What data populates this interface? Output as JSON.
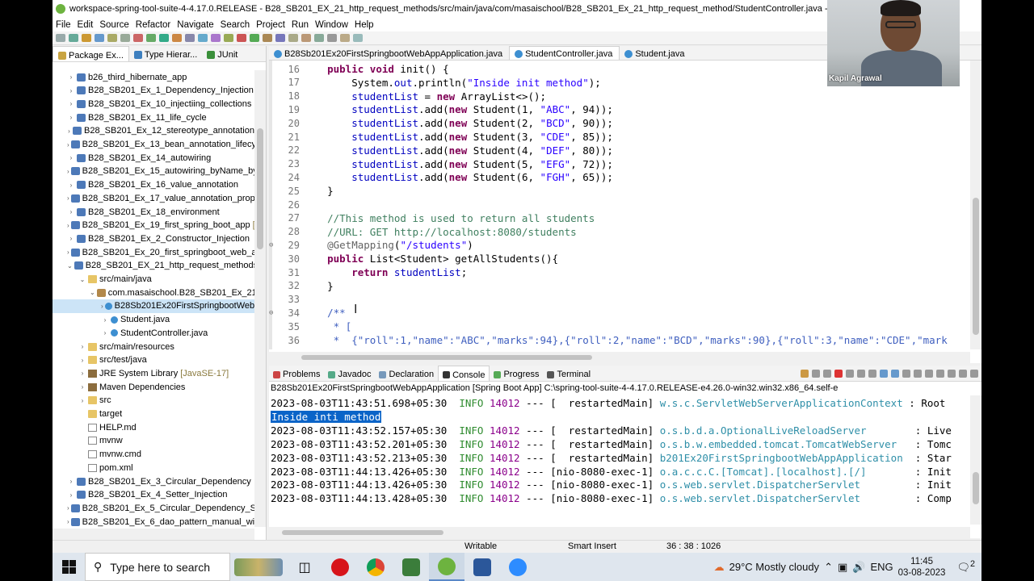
{
  "window": {
    "title": "workspace-spring-tool-suite-4-4.17.0.RELEASE - B28_SB201_EX_21_http_request_methods/src/main/java/com/masaischool/B28_SB201_Ex_21_http_request_method/StudentController.java - Spring Too"
  },
  "menu": [
    "File",
    "Edit",
    "Source",
    "Refactor",
    "Navigate",
    "Search",
    "Project",
    "Run",
    "Window",
    "Help"
  ],
  "left_panel": {
    "tabs": [
      {
        "label": "Package Ex..."
      },
      {
        "label": "Type Hierar..."
      },
      {
        "label": "JUnit"
      }
    ],
    "tree": [
      {
        "indent": 0,
        "arrow": "›",
        "icon": "proj",
        "label": "b26_third_hibernate_app",
        "deco": ""
      },
      {
        "indent": 0,
        "arrow": "›",
        "icon": "proj",
        "label": "B28_SB201_Ex_1_Dependency_Injection",
        "deco": ""
      },
      {
        "indent": 0,
        "arrow": "›",
        "icon": "proj",
        "label": "B28_SB201_Ex_10_injectiing_collections",
        "deco": ""
      },
      {
        "indent": 0,
        "arrow": "›",
        "icon": "proj",
        "label": "B28_SB201_Ex_11_life_cycle",
        "deco": ""
      },
      {
        "indent": 0,
        "arrow": "›",
        "icon": "proj",
        "label": "B28_SB201_Ex_12_stereotype_annotation",
        "deco": ""
      },
      {
        "indent": 0,
        "arrow": "›",
        "icon": "proj",
        "label": "B28_SB201_Ex_13_bean_annotation_lifecyle",
        "deco": ""
      },
      {
        "indent": 0,
        "arrow": "›",
        "icon": "proj",
        "label": "B28_SB201_Ex_14_autowiring",
        "deco": ""
      },
      {
        "indent": 0,
        "arrow": "›",
        "icon": "proj",
        "label": "B28_SB201_Ex_15_autowiring_byName_byTy",
        "deco": ""
      },
      {
        "indent": 0,
        "arrow": "›",
        "icon": "proj",
        "label": "B28_SB201_Ex_16_value_annotation",
        "deco": ""
      },
      {
        "indent": 0,
        "arrow": "›",
        "icon": "proj",
        "label": "B28_SB201_Ex_17_value_annotation_propert",
        "deco": ""
      },
      {
        "indent": 0,
        "arrow": "›",
        "icon": "proj",
        "label": "B28_SB201_Ex_18_environment",
        "deco": ""
      },
      {
        "indent": 0,
        "arrow": "›",
        "icon": "proj",
        "label": "B28_SB201_Ex_19_first_spring_boot_app",
        "deco": "[bc"
      },
      {
        "indent": 0,
        "arrow": "›",
        "icon": "proj",
        "label": "B28_SB201_Ex_2_Constructor_Injection",
        "deco": ""
      },
      {
        "indent": 0,
        "arrow": "›",
        "icon": "proj",
        "label": "B28_SB201_Ex_20_first_springboot_web_app",
        "deco": ""
      },
      {
        "indent": 0,
        "arrow": "⌄",
        "icon": "proj",
        "label": "B28_SB201_EX_21_http_request_methods",
        "deco": "[b"
      },
      {
        "indent": 1,
        "arrow": "⌄",
        "icon": "folder",
        "label": "src/main/java",
        "deco": ""
      },
      {
        "indent": 2,
        "arrow": "⌄",
        "icon": "pkg",
        "label": "com.masaischool.B28_SB201_Ex_21_h",
        "deco": ""
      },
      {
        "indent": 3,
        "arrow": "›",
        "icon": "jfile",
        "label": "B28Sb201Ex20FirstSpringbootWeb",
        "deco": "",
        "selected": true
      },
      {
        "indent": 3,
        "arrow": "›",
        "icon": "jfile",
        "label": "Student.java",
        "deco": ""
      },
      {
        "indent": 3,
        "arrow": "›",
        "icon": "jfile",
        "label": "StudentController.java",
        "deco": ""
      },
      {
        "indent": 1,
        "arrow": "›",
        "icon": "folder",
        "label": "src/main/resources",
        "deco": ""
      },
      {
        "indent": 1,
        "arrow": "›",
        "icon": "folder",
        "label": "src/test/java",
        "deco": ""
      },
      {
        "indent": 1,
        "arrow": "›",
        "icon": "jar",
        "label": "JRE System Library",
        "deco": "[JavaSE-17]"
      },
      {
        "indent": 1,
        "arrow": "›",
        "icon": "jar",
        "label": "Maven Dependencies",
        "deco": ""
      },
      {
        "indent": 1,
        "arrow": "›",
        "icon": "folder",
        "label": "src",
        "deco": ""
      },
      {
        "indent": 1,
        "arrow": "",
        "icon": "folder",
        "label": "target",
        "deco": ""
      },
      {
        "indent": 1,
        "arrow": "",
        "icon": "doc",
        "label": "HELP.md",
        "deco": ""
      },
      {
        "indent": 1,
        "arrow": "",
        "icon": "doc",
        "label": "mvnw",
        "deco": ""
      },
      {
        "indent": 1,
        "arrow": "",
        "icon": "doc",
        "label": "mvnw.cmd",
        "deco": ""
      },
      {
        "indent": 1,
        "arrow": "",
        "icon": "doc",
        "label": "pom.xml",
        "deco": ""
      },
      {
        "indent": 0,
        "arrow": "›",
        "icon": "proj",
        "label": "B28_SB201_Ex_3_Circular_Dependency",
        "deco": ""
      },
      {
        "indent": 0,
        "arrow": "›",
        "icon": "proj",
        "label": "B28_SB201_Ex_4_Setter_Injection",
        "deco": ""
      },
      {
        "indent": 0,
        "arrow": "›",
        "icon": "proj",
        "label": "B28_SB201_Ex_5_Circular_Dependency_Solut",
        "deco": ""
      },
      {
        "indent": 0,
        "arrow": "›",
        "icon": "proj",
        "label": "B28_SB201_Ex_6_dao_pattern_manual_wirin",
        "deco": ""
      }
    ]
  },
  "editor": {
    "tabs": [
      {
        "label": "B28Sb201Ex20FirstSpringbootWebAppApplication.java",
        "active": false
      },
      {
        "label": "StudentController.java",
        "active": true
      },
      {
        "label": "Student.java",
        "active": false
      }
    ],
    "lines": [
      {
        "n": "16",
        "marker": "",
        "segs": [
          [
            "",
            "    "
          ],
          [
            "kw",
            "public void"
          ],
          [
            "",
            " init() {"
          ]
        ]
      },
      {
        "n": "17",
        "marker": "",
        "segs": [
          [
            "",
            "        System."
          ],
          [
            "fld",
            "out"
          ],
          [
            "",
            ".println("
          ],
          [
            "str",
            "\"Inside init method\""
          ],
          [
            "",
            ");"
          ]
        ]
      },
      {
        "n": "18",
        "marker": "",
        "segs": [
          [
            "",
            "        "
          ],
          [
            "fld",
            "studentList"
          ],
          [
            "",
            " = "
          ],
          [
            "kw",
            "new"
          ],
          [
            "",
            " ArrayList<>();"
          ]
        ]
      },
      {
        "n": "19",
        "marker": "",
        "segs": [
          [
            "",
            "        "
          ],
          [
            "fld",
            "studentList"
          ],
          [
            "",
            ".add("
          ],
          [
            "kw",
            "new"
          ],
          [
            "",
            " Student(1, "
          ],
          [
            "str",
            "\"ABC\""
          ],
          [
            "",
            ", 94));"
          ]
        ]
      },
      {
        "n": "20",
        "marker": "",
        "segs": [
          [
            "",
            "        "
          ],
          [
            "fld",
            "studentList"
          ],
          [
            "",
            ".add("
          ],
          [
            "kw",
            "new"
          ],
          [
            "",
            " Student(2, "
          ],
          [
            "str",
            "\"BCD\""
          ],
          [
            "",
            ", 90));"
          ]
        ]
      },
      {
        "n": "21",
        "marker": "",
        "segs": [
          [
            "",
            "        "
          ],
          [
            "fld",
            "studentList"
          ],
          [
            "",
            ".add("
          ],
          [
            "kw",
            "new"
          ],
          [
            "",
            " Student(3, "
          ],
          [
            "str",
            "\"CDE\""
          ],
          [
            "",
            ", 85));"
          ]
        ]
      },
      {
        "n": "22",
        "marker": "",
        "segs": [
          [
            "",
            "        "
          ],
          [
            "fld",
            "studentList"
          ],
          [
            "",
            ".add("
          ],
          [
            "kw",
            "new"
          ],
          [
            "",
            " Student(4, "
          ],
          [
            "str",
            "\"DEF\""
          ],
          [
            "",
            ", 80));"
          ]
        ]
      },
      {
        "n": "23",
        "marker": "",
        "segs": [
          [
            "",
            "        "
          ],
          [
            "fld",
            "studentList"
          ],
          [
            "",
            ".add("
          ],
          [
            "kw",
            "new"
          ],
          [
            "",
            " Student(5, "
          ],
          [
            "str",
            "\"EFG\""
          ],
          [
            "",
            ", 72));"
          ]
        ]
      },
      {
        "n": "24",
        "marker": "",
        "segs": [
          [
            "",
            "        "
          ],
          [
            "fld",
            "studentList"
          ],
          [
            "",
            ".add("
          ],
          [
            "kw",
            "new"
          ],
          [
            "",
            " Student(6, "
          ],
          [
            "str",
            "\"FGH\""
          ],
          [
            "",
            ", 65));"
          ]
        ]
      },
      {
        "n": "25",
        "marker": "",
        "segs": [
          [
            "",
            "    }"
          ]
        ]
      },
      {
        "n": "26",
        "marker": "",
        "segs": [
          [
            "",
            ""
          ]
        ]
      },
      {
        "n": "27",
        "marker": "",
        "segs": [
          [
            "",
            "    "
          ],
          [
            "cm",
            "//This method is used to return all students"
          ]
        ]
      },
      {
        "n": "28",
        "marker": "",
        "segs": [
          [
            "",
            "    "
          ],
          [
            "cm",
            "//URL: GET http://localhost:8080/students"
          ]
        ]
      },
      {
        "n": "29",
        "marker": "⊖",
        "segs": [
          [
            "",
            "    "
          ],
          [
            "ann",
            "@GetMapping"
          ],
          [
            "",
            "("
          ],
          [
            "str",
            "\"/students\""
          ],
          [
            "",
            ")"
          ]
        ]
      },
      {
        "n": "30",
        "marker": "",
        "segs": [
          [
            "",
            "    "
          ],
          [
            "kw",
            "public"
          ],
          [
            "",
            " List<Student> getAllStudents(){"
          ]
        ]
      },
      {
        "n": "31",
        "marker": "",
        "segs": [
          [
            "",
            "        "
          ],
          [
            "kw",
            "return"
          ],
          [
            "",
            " "
          ],
          [
            "fld",
            "studentList"
          ],
          [
            "",
            ";"
          ]
        ]
      },
      {
        "n": "32",
        "marker": "",
        "segs": [
          [
            "",
            "    }"
          ]
        ]
      },
      {
        "n": "33",
        "marker": "",
        "segs": [
          [
            "",
            ""
          ]
        ]
      },
      {
        "n": "34",
        "marker": "⊖",
        "segs": [
          [
            "",
            "    "
          ],
          [
            "javadoc",
            "/**"
          ]
        ]
      },
      {
        "n": "35",
        "marker": "",
        "segs": [
          [
            "",
            "     "
          ],
          [
            "javadoc",
            "* ["
          ]
        ]
      },
      {
        "n": "36",
        "marker": "",
        "segs": [
          [
            "",
            "     "
          ],
          [
            "javadoc",
            "*  {\"roll\":1,\"name\":\"ABC\",\"marks\":94},{\"roll\":2,\"name\":\"BCD\",\"marks\":90},{\"roll\":3,\"name\":\"CDE\",\"mark"
          ]
        ]
      }
    ]
  },
  "console": {
    "tabs": [
      {
        "label": "Problems",
        "active": false
      },
      {
        "label": "Javadoc",
        "active": false
      },
      {
        "label": "Declaration",
        "active": false
      },
      {
        "label": "Console",
        "active": true
      },
      {
        "label": "Progress",
        "active": false
      },
      {
        "label": "Terminal",
        "active": false
      }
    ],
    "description": "B28Sb201Ex20FirstSpringbootWebAppApplication [Spring Boot App] C:\\spring-tool-suite-4-4.17.0.RELEASE-e4.26.0-win32.win32.x86_64.self-e",
    "highlight": "Inside inti method",
    "logs": [
      {
        "ts": "2023-08-03T11:43:51.698+05:30",
        "level": "INFO",
        "pid": "14012",
        "sep": "---",
        "thread": "[  restartedMain]",
        "cls": "w.s.c.ServletWebServerApplicationContext",
        "msg": ": Root"
      },
      {
        "highlight": true
      },
      {
        "ts": "2023-08-03T11:43:52.157+05:30",
        "level": "INFO",
        "pid": "14012",
        "sep": "---",
        "thread": "[  restartedMain]",
        "cls": "o.s.b.d.a.OptionalLiveReloadServer       ",
        "msg": ": Live"
      },
      {
        "ts": "2023-08-03T11:43:52.201+05:30",
        "level": "INFO",
        "pid": "14012",
        "sep": "---",
        "thread": "[  restartedMain]",
        "cls": "o.s.b.w.embedded.tomcat.TomcatWebServer  ",
        "msg": ": Tomc"
      },
      {
        "ts": "2023-08-03T11:43:52.213+05:30",
        "level": "INFO",
        "pid": "14012",
        "sep": "---",
        "thread": "[  restartedMain]",
        "cls": "b201Ex20FirstSpringbootWebAppApplication ",
        "msg": ": Star"
      },
      {
        "ts": "2023-08-03T11:44:13.426+05:30",
        "level": "INFO",
        "pid": "14012",
        "sep": "---",
        "thread": "[nio-8080-exec-1]",
        "cls": "o.a.c.c.C.[Tomcat].[localhost].[/]       ",
        "msg": ": Init"
      },
      {
        "ts": "2023-08-03T11:44:13.426+05:30",
        "level": "INFO",
        "pid": "14012",
        "sep": "---",
        "thread": "[nio-8080-exec-1]",
        "cls": "o.s.web.servlet.DispatcherServlet        ",
        "msg": ": Init"
      },
      {
        "ts": "2023-08-03T11:44:13.428+05:30",
        "level": "INFO",
        "pid": "14012",
        "sep": "---",
        "thread": "[nio-8080-exec-1]",
        "cls": "o.s.web.servlet.DispatcherServlet        ",
        "msg": ": Comp"
      }
    ]
  },
  "statusbar": {
    "mode": "Writable",
    "insert": "Smart Insert",
    "position": "36 : 38 : 1026"
  },
  "webcam": {
    "name": "Kapil Agrawal"
  },
  "taskbar": {
    "search_placeholder": "Type here to search",
    "weather": "29°C  Mostly cloudy",
    "lang": "ENG",
    "time": "11:45",
    "date": "03-08-2023",
    "notifications": "2"
  },
  "colors": {
    "keyword": "#7f0055",
    "string": "#2a00ff",
    "field": "#0000c0",
    "comment": "#3f7f5f",
    "info": "#2e8b2e",
    "selection": "#0a64c8"
  }
}
